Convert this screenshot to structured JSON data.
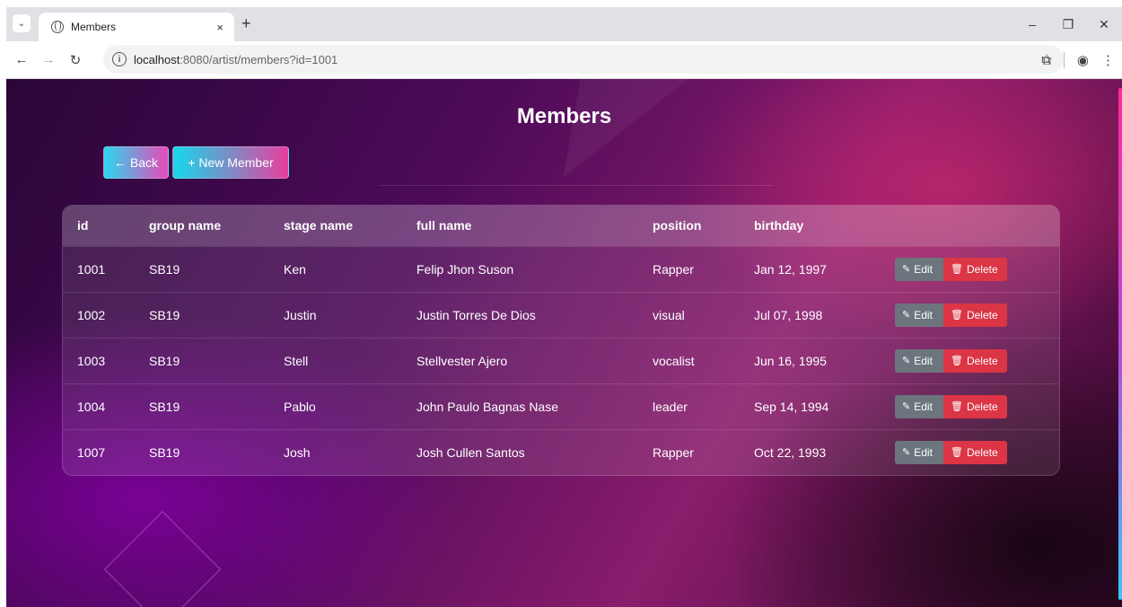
{
  "browser": {
    "tab_title": "Members",
    "tab_close": "×",
    "new_tab": "+",
    "url_host": "localhost",
    "url_path": ":8080/artist/members?id=1001",
    "window_controls": {
      "minimize": "–",
      "restore": "❐",
      "close": "✕"
    }
  },
  "page": {
    "title": "Members",
    "back_label": "← Back",
    "new_member_label": "+ New Member"
  },
  "table": {
    "headers": {
      "id": "id",
      "group_name": "group name",
      "stage_name": "stage name",
      "full_name": "full name",
      "position": "position",
      "birthday": "birthday"
    },
    "rows": [
      {
        "id": "1001",
        "group_name": "SB19",
        "stage_name": "Ken",
        "full_name": "Felip Jhon Suson",
        "position": "Rapper",
        "birthday": "Jan 12, 1997"
      },
      {
        "id": "1002",
        "group_name": "SB19",
        "stage_name": "Justin",
        "full_name": "Justin Torres De Dios",
        "position": "visual",
        "birthday": "Jul 07, 1998"
      },
      {
        "id": "1003",
        "group_name": "SB19",
        "stage_name": "Stell",
        "full_name": "Stellvester Ajero",
        "position": "vocalist",
        "birthday": "Jun 16, 1995"
      },
      {
        "id": "1004",
        "group_name": "SB19",
        "stage_name": "Pablo",
        "full_name": "John Paulo Bagnas Nase",
        "position": "leader",
        "birthday": "Sep 14, 1994"
      },
      {
        "id": "1007",
        "group_name": "SB19",
        "stage_name": "Josh",
        "full_name": "Josh Cullen Santos",
        "position": "Rapper",
        "birthday": "Oct 22, 1993"
      }
    ],
    "edit_label": "Edit",
    "delete_label": "Delete"
  },
  "colors": {
    "edit_button": "#6c757d",
    "delete_button": "#dc3545",
    "accent_cyan": "#2bd6f0",
    "accent_pink": "#e84ab8"
  },
  "icons": {
    "edit": "pencil-icon",
    "delete": "trash-icon",
    "back": "arrow-left-icon",
    "new": "plus-icon"
  }
}
